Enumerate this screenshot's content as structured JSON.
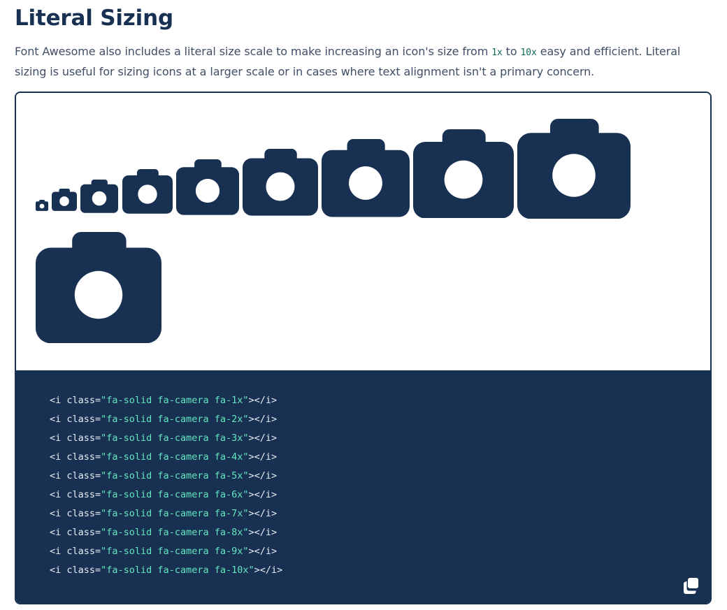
{
  "section": {
    "title": "Literal Sizing",
    "desc_before": "Font Awesome also includes a literal size scale to make increasing an icon's size from ",
    "code_from": "1x",
    "desc_middle": " to ",
    "code_to": "10x",
    "desc_after": " easy and efficient. Literal sizing is useful for sizing icons at a larger scale or in cases where text alignment isn't a primary concern."
  },
  "preview": {
    "icon": "camera-icon",
    "icon_color": "#183153",
    "sizes": [
      "1x",
      "2x",
      "3x",
      "4x",
      "5x",
      "6x",
      "7x",
      "8x",
      "9x",
      "10x"
    ]
  },
  "code": {
    "lines": [
      {
        "open": "<i class=",
        "value": "\"fa-solid fa-camera fa-1x\"",
        "close": "></i>"
      },
      {
        "open": "<i class=",
        "value": "\"fa-solid fa-camera fa-2x\"",
        "close": "></i>"
      },
      {
        "open": "<i class=",
        "value": "\"fa-solid fa-camera fa-3x\"",
        "close": "></i>"
      },
      {
        "open": "<i class=",
        "value": "\"fa-solid fa-camera fa-4x\"",
        "close": "></i>"
      },
      {
        "open": "<i class=",
        "value": "\"fa-solid fa-camera fa-5x\"",
        "close": "></i>"
      },
      {
        "open": "<i class=",
        "value": "\"fa-solid fa-camera fa-6x\"",
        "close": "></i>"
      },
      {
        "open": "<i class=",
        "value": "\"fa-solid fa-camera fa-7x\"",
        "close": "></i>"
      },
      {
        "open": "<i class=",
        "value": "\"fa-solid fa-camera fa-8x\"",
        "close": "></i>"
      },
      {
        "open": "<i class=",
        "value": "\"fa-solid fa-camera fa-9x\"",
        "close": "></i>"
      },
      {
        "open": "<i class=",
        "value": "\"fa-solid fa-camera fa-10x\"",
        "close": "></i>"
      }
    ],
    "copy_icon": "copy-icon"
  },
  "colors": {
    "navy": "#183153",
    "string": "#63e6be",
    "code_text": "#e6ecf3"
  }
}
